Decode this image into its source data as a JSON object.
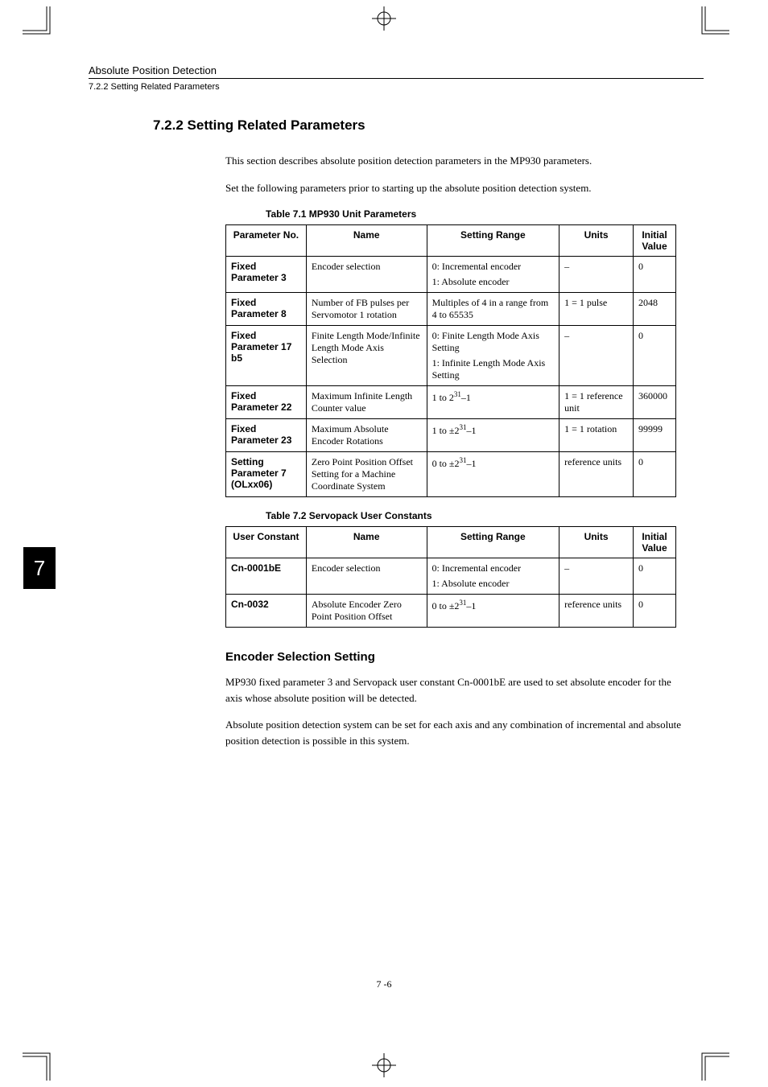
{
  "running_head": "Absolute Position Detection",
  "sub_head": "7.2.2  Setting Related Parameters",
  "section_number_title": "7.2.2  Setting Related Parameters",
  "intro_1": "This section describes absolute position detection parameters in the MP930 parameters.",
  "intro_2": "Set the following parameters prior to starting up the absolute position detection system.",
  "table1_caption": "Table 7.1    MP930 Unit Parameters",
  "table1_headers": {
    "c1": "Parameter No.",
    "c2": "Name",
    "c3": "Setting Range",
    "c4": "Units",
    "c5": "Initial Value"
  },
  "table1_rows": [
    {
      "param": "Fixed Parameter 3",
      "name": "Encoder selection",
      "range_a": "0: Incremental encoder",
      "range_b": "1: Absolute encoder",
      "units": "–",
      "init": "0"
    },
    {
      "param": "Fixed Parameter 8",
      "name": "Number of FB pulses per Servomotor 1 rotation",
      "range_a": "Multiples of 4 in a range from 4 to 65535",
      "range_b": "",
      "units": "1 = 1 pulse",
      "init": "2048"
    },
    {
      "param": "Fixed Parameter 17 b5",
      "name": "Finite Length Mode/Infinite Length Mode Axis Selection",
      "range_a": "0: Finite Length Mode Axis Setting",
      "range_b": "1: Infinite Length Mode Axis Setting",
      "units": "–",
      "init": "0"
    },
    {
      "param": "Fixed Parameter 22",
      "name": "Maximum Infinite Length Counter value",
      "range_pre": "1 to 2",
      "range_sup": "31",
      "range_post": "–1",
      "units": "1 = 1 reference unit",
      "init": "360000"
    },
    {
      "param": "Fixed Parameter 23",
      "name": "Maximum Absolute Encoder Rotations",
      "range_pre": "1 to ±2",
      "range_sup": "31",
      "range_post": "–1",
      "units": "1 = 1 rotation",
      "init": "99999"
    },
    {
      "param": "Setting Parameter 7 (OLxx06)",
      "name": "Zero Point Position Offset Setting for a Machine Coordinate System",
      "range_pre": "0 to ±2",
      "range_sup": "31",
      "range_post": "–1",
      "units": "reference units",
      "init": "0"
    }
  ],
  "table2_caption": "Table 7.2    Servopack User Constants",
  "table2_headers": {
    "c1": "User Constant",
    "c2": "Name",
    "c3": "Setting Range",
    "c4": "Units",
    "c5": "Initial Value"
  },
  "table2_rows": [
    {
      "param": "Cn-0001bE",
      "name": "Encoder selection",
      "range_a": "0: Incremental encoder",
      "range_b": "1: Absolute encoder",
      "units": "–",
      "init": "0"
    },
    {
      "param": "Cn-0032",
      "name": "Absolute Encoder Zero Point Position Offset",
      "range_pre": "0 to ±2",
      "range_sup": "31",
      "range_post": "–1",
      "units": "reference units",
      "init": "0"
    }
  ],
  "subheading": "Encoder Selection Setting",
  "para1": "MP930 fixed parameter 3 and Servopack user constant Cn-0001bE are used to set absolute encoder for the axis whose absolute position will be detected.",
  "para2": "Absolute position detection system can be set for each axis and any combination of incremental and absolute position detection is possible in this system.",
  "side_tab": "7",
  "page_number": "7 -6"
}
